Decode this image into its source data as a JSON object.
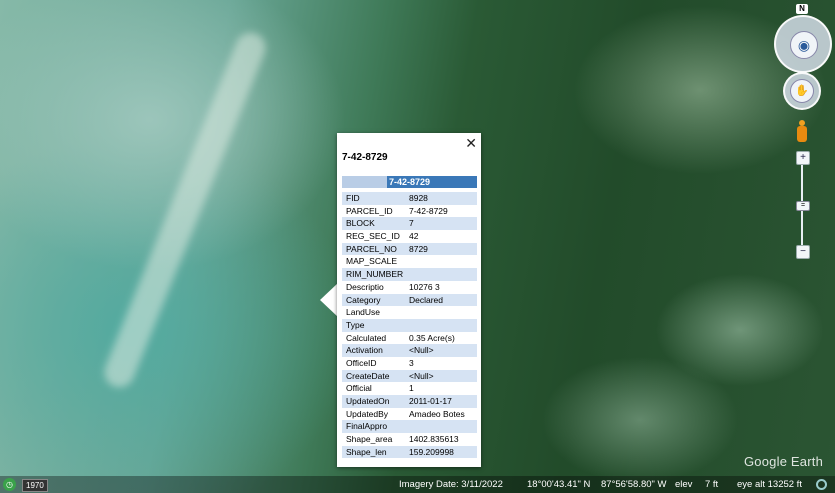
{
  "popup": {
    "close_symbol": "✕",
    "title": "7-42-8729",
    "header": "7-42-8729",
    "rows": [
      {
        "key": "FID",
        "value": "8928"
      },
      {
        "key": "PARCEL_ID",
        "value": "7-42-8729"
      },
      {
        "key": "BLOCK",
        "value": "7"
      },
      {
        "key": "REG_SEC_ID",
        "value": "42"
      },
      {
        "key": "PARCEL_NO",
        "value": "8729"
      },
      {
        "key": "MAP_SCALE",
        "value": ""
      },
      {
        "key": "RIM_NUMBER",
        "value": ""
      },
      {
        "key": "Descriptio",
        "value": "10276 3"
      },
      {
        "key": "Category",
        "value": "Declared"
      },
      {
        "key": "LandUse",
        "value": ""
      },
      {
        "key": "Type",
        "value": ""
      },
      {
        "key": "Calculated",
        "value": "0.35 Acre(s)"
      },
      {
        "key": "Activation",
        "value": "<Null>"
      },
      {
        "key": "OfficeID",
        "value": "3"
      },
      {
        "key": "CreateDate",
        "value": "<Null>"
      },
      {
        "key": "Official",
        "value": "1"
      },
      {
        "key": "UpdatedOn",
        "value": "2011-01-17"
      },
      {
        "key": "UpdatedBy",
        "value": "Amadeo Botes"
      },
      {
        "key": "FinalAppro",
        "value": ""
      },
      {
        "key": "Shape_area",
        "value": "1402.835613"
      },
      {
        "key": "Shape_len",
        "value": "159.209998"
      }
    ]
  },
  "nav": {
    "north_label": "N",
    "look_icon": "eye-icon",
    "move_icon": "hand-icon",
    "zoom_in": "+",
    "zoom_out": "−",
    "zoom_thumb": "="
  },
  "status": {
    "year": "1970",
    "imagery_date": "Imagery Date: 3/11/2022",
    "lat": "18°00'43.41\" N",
    "lon": "87°56'58.80\" W",
    "elev_label": "elev",
    "elev_value": "7 ft",
    "eye_alt": "eye alt  13252 ft"
  },
  "brand": "Google Earth"
}
